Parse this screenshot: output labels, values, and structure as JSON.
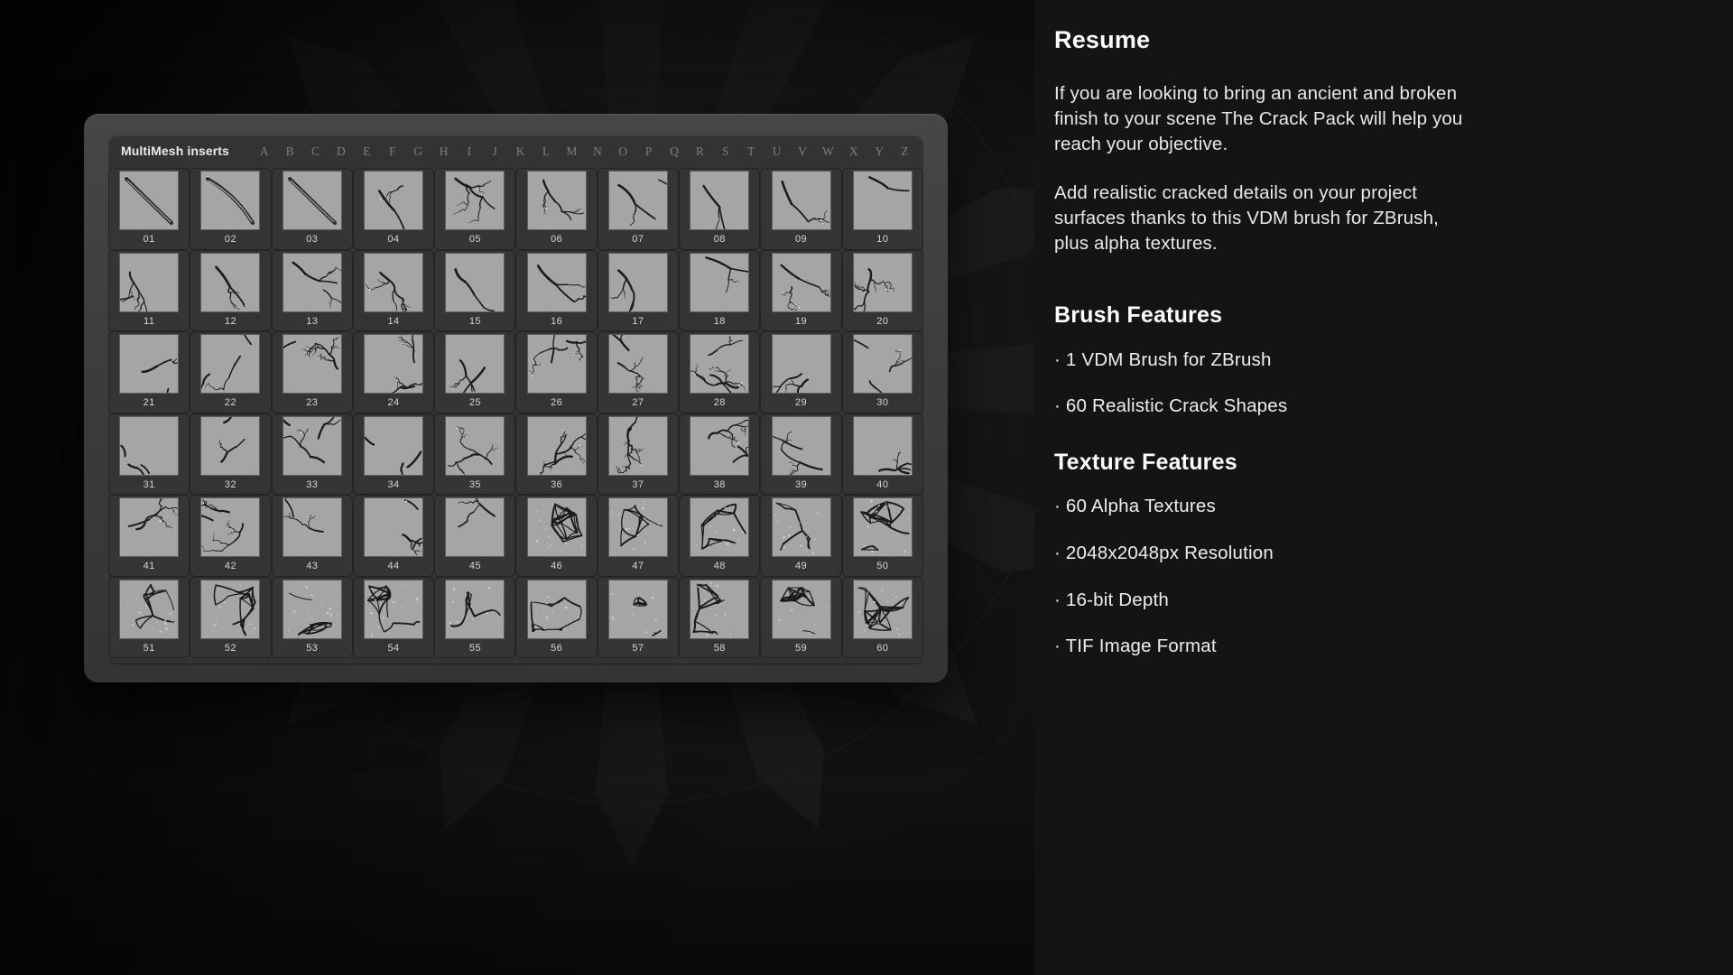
{
  "window": {
    "panel_title": "MultiMesh inserts",
    "alphabet": [
      "A",
      "B",
      "C",
      "D",
      "E",
      "F",
      "G",
      "H",
      "I",
      "J",
      "K",
      "L",
      "M",
      "N",
      "O",
      "P",
      "Q",
      "R",
      "S",
      "T",
      "U",
      "V",
      "W",
      "X",
      "Y",
      "Z"
    ],
    "thumbnail_labels": [
      "01",
      "02",
      "03",
      "04",
      "05",
      "06",
      "07",
      "08",
      "09",
      "10",
      "11",
      "12",
      "13",
      "14",
      "15",
      "16",
      "17",
      "18",
      "19",
      "20",
      "21",
      "22",
      "23",
      "24",
      "25",
      "26",
      "27",
      "28",
      "29",
      "30",
      "31",
      "32",
      "33",
      "34",
      "35",
      "36",
      "37",
      "38",
      "39",
      "40",
      "41",
      "42",
      "43",
      "44",
      "45",
      "46",
      "47",
      "48",
      "49",
      "50",
      "51",
      "52",
      "53",
      "54",
      "55",
      "56",
      "57",
      "58",
      "59",
      "60"
    ],
    "thumbnail_count": 60,
    "columns": 10,
    "rows": 6
  },
  "sidebar": {
    "resume": {
      "heading": "Resume",
      "paragraph_1": "If you are looking to bring an ancient and broken finish to your scene The Crack Pack will help you reach your objective.",
      "paragraph_2": "Add realistic cracked details on your project surfaces thanks to this VDM brush for ZBrush, plus alpha textures."
    },
    "brush_features": {
      "heading": "Brush Features",
      "items": [
        "· 1 VDM Brush for ZBrush",
        "· 60 Realistic Crack Shapes"
      ]
    },
    "texture_features": {
      "heading": "Texture Features",
      "items": [
        "· 60 Alpha Textures",
        "· 2048x2048px Resolution",
        "· 16-bit Depth",
        "· TIF Image Format"
      ]
    }
  },
  "colors": {
    "page_background": "#111111",
    "sidebar_background": "#141414",
    "window_frame": "#3d3d3d",
    "panel_background": "#333333",
    "thumbnail_background": "#a5a5a5",
    "crack_color": "#141414",
    "text_primary": "#ffffff",
    "text_secondary": "#e8e8e8",
    "alphabet_label": "#7d7d7d"
  }
}
